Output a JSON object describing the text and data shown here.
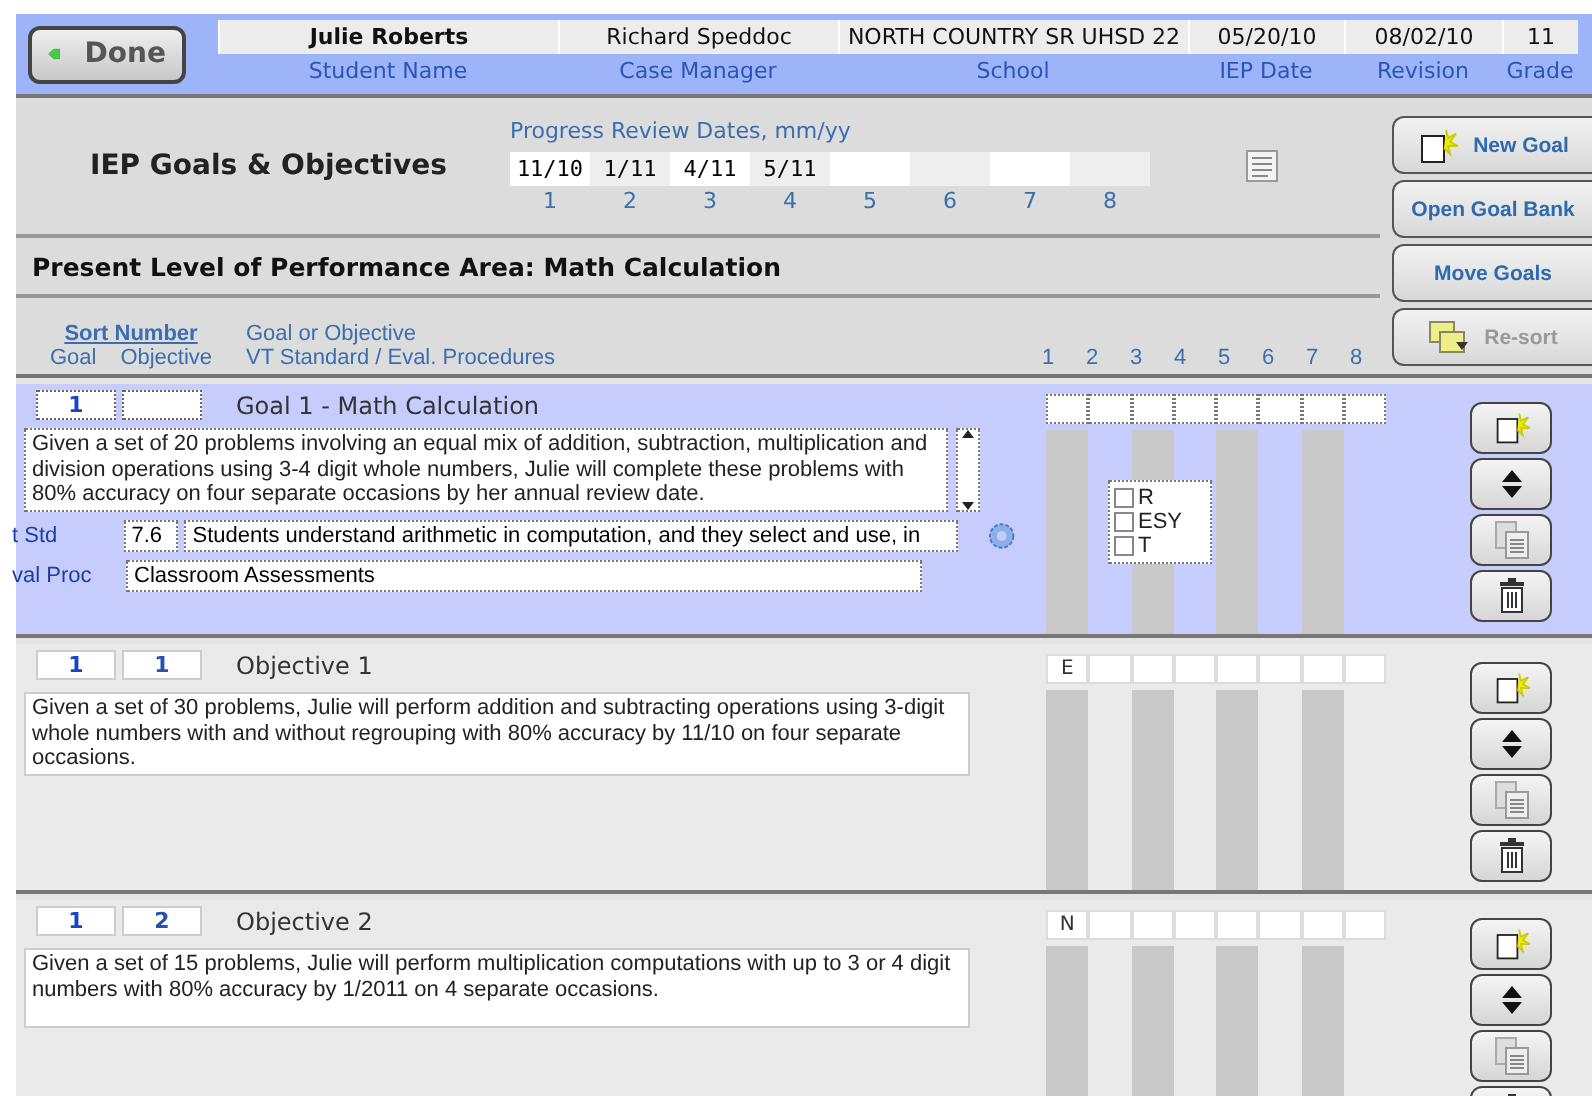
{
  "header": {
    "done": "Done",
    "fields": [
      {
        "value": "Julie Roberts",
        "label": "Student Name",
        "kind": "name"
      },
      {
        "value": "Richard Speddoc",
        "label": "Case Manager",
        "kind": "plain"
      },
      {
        "value": "NORTH COUNTRY SR UHSD 22",
        "label": "School",
        "kind": "plain"
      },
      {
        "value": "05/20/10",
        "label": "IEP Date",
        "kind": "plain"
      },
      {
        "value": "08/02/10",
        "label": "Revision",
        "kind": "plain"
      },
      {
        "value": "11",
        "label": "Grade",
        "kind": "plain"
      }
    ]
  },
  "title": "IEP Goals & Objectives",
  "progress": {
    "label": "Progress Review Dates, mm/yy",
    "dates": [
      {
        "number": "1",
        "date": "11/10"
      },
      {
        "number": "2",
        "date": "1/11"
      },
      {
        "number": "3",
        "date": "4/11"
      },
      {
        "number": "4",
        "date": "5/11"
      },
      {
        "number": "5"
      },
      {
        "number": "6"
      },
      {
        "number": "7"
      },
      {
        "number": "8"
      }
    ]
  },
  "side_buttons": [
    {
      "label": "New Goal",
      "kind": "new",
      "disabled": false
    },
    {
      "label": "Open Goal Bank",
      "kind": "plain",
      "disabled": false
    },
    {
      "label": "Move Goals",
      "kind": "plain",
      "disabled": false
    },
    {
      "label": "Re-sort",
      "kind": "resort",
      "disabled": true
    }
  ],
  "performance_area": "Present Level of Performance Area: Math Calculation",
  "list_header": {
    "sort": "Sort Number",
    "goal": "Goal",
    "objective": "Objective",
    "text": "Goal or Objective",
    "standard": "VT Standard / Eval. Procedures",
    "columns": [
      "1",
      "2",
      "3",
      "4",
      "5",
      "6",
      "7",
      "8"
    ]
  },
  "items": [
    {
      "kind": "goal",
      "goal_no": "1",
      "title": "Goal 1 - Math Calculation",
      "text": "Given a set of 20 problems involving an equal mix of addition, subtraction, multiplication and division operations using 3-4  digit whole numbers, Julie will complete these problems with 80% accuracy on four separate occasions by her annual review date.",
      "standard_label": "t Std",
      "standard_no": "7.6",
      "standard_text": "Students understand arithmetic in computation, and they select and use, in",
      "eval_label": "val Proc",
      "eval_text": "Classroom Assessments",
      "options": [
        {
          "label": "R",
          "checked": false
        },
        {
          "label": "ESY",
          "checked": false
        },
        {
          "label": "T",
          "checked": false
        }
      ]
    },
    {
      "kind": "objective",
      "goal_no": "1",
      "objective_no": "1",
      "title": "Objective 1",
      "text": "Given a set of 30 problems, Julie will perform addition and subtracting operations using 3-digit whole numbers with and without regrouping with 80% accuracy by 11/10 on four separate occasions.",
      "mark": "E"
    },
    {
      "kind": "objective",
      "goal_no": "1",
      "objective_no": "2",
      "title": "Objective 2",
      "text": "Given a set of 15 problems, Julie will perform multiplication computations with up to 3 or 4 digit numbers with 80% accuracy by 1/2011 on 4 separate occasions.",
      "mark": "N"
    }
  ]
}
